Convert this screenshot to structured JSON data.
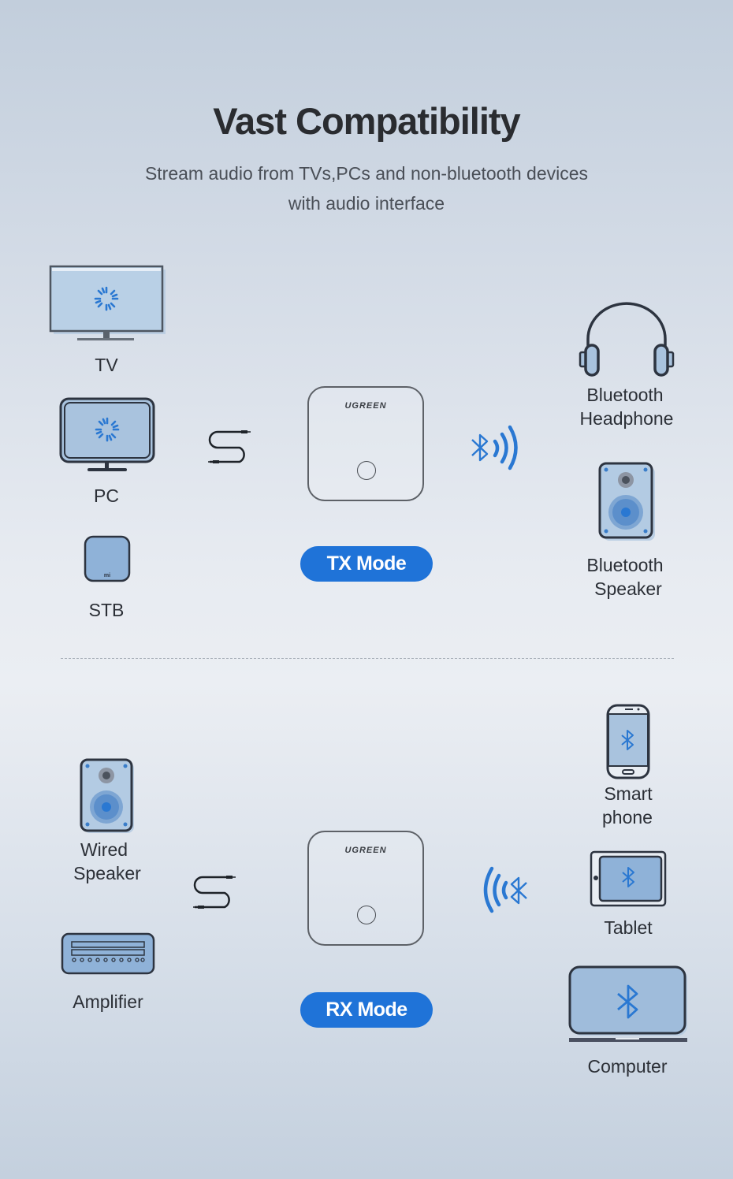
{
  "header": {
    "title": "Vast Compatibility",
    "subtitle": "Stream audio from TVs,PCs and non-bluetooth devices with audio interface"
  },
  "colors": {
    "accent": "#1f73d8",
    "device_fill": "#a9c3de",
    "outline": "#2d3440",
    "bluetooth": "#2a78d2"
  },
  "tx_section": {
    "mode_label": "TX Mode",
    "device_brand": "UGREEN",
    "sources": [
      {
        "label": "TV",
        "icon": "tv-icon"
      },
      {
        "label": "PC",
        "icon": "monitor-icon"
      },
      {
        "label": "STB",
        "icon": "set-top-box-icon",
        "badge": "mi"
      }
    ],
    "targets": [
      {
        "label_line1": "Bluetooth",
        "label_line2": "Headphone",
        "icon": "headphone-icon"
      },
      {
        "label_line1": "Bluetooth",
        "label_line2": "Speaker",
        "icon": "speaker-icon"
      }
    ],
    "connector_icon": "aux-cable-icon",
    "signal_icon": "bluetooth-transmit-icon"
  },
  "rx_section": {
    "mode_label": "RX Mode",
    "device_brand": "UGREEN",
    "outputs": [
      {
        "label_line1": "Wired",
        "label_line2": "Speaker",
        "icon": "speaker-icon"
      },
      {
        "label_line1": "Amplifier",
        "label_line2": "",
        "icon": "amplifier-icon"
      }
    ],
    "sources": [
      {
        "label_line1": "Smart",
        "label_line2": "phone",
        "icon": "smartphone-icon"
      },
      {
        "label_line1": "Tablet",
        "label_line2": "",
        "icon": "tablet-icon"
      },
      {
        "label_line1": "Computer",
        "label_line2": "",
        "icon": "laptop-icon"
      }
    ],
    "connector_icon": "aux-cable-icon",
    "signal_icon": "bluetooth-receive-icon"
  }
}
